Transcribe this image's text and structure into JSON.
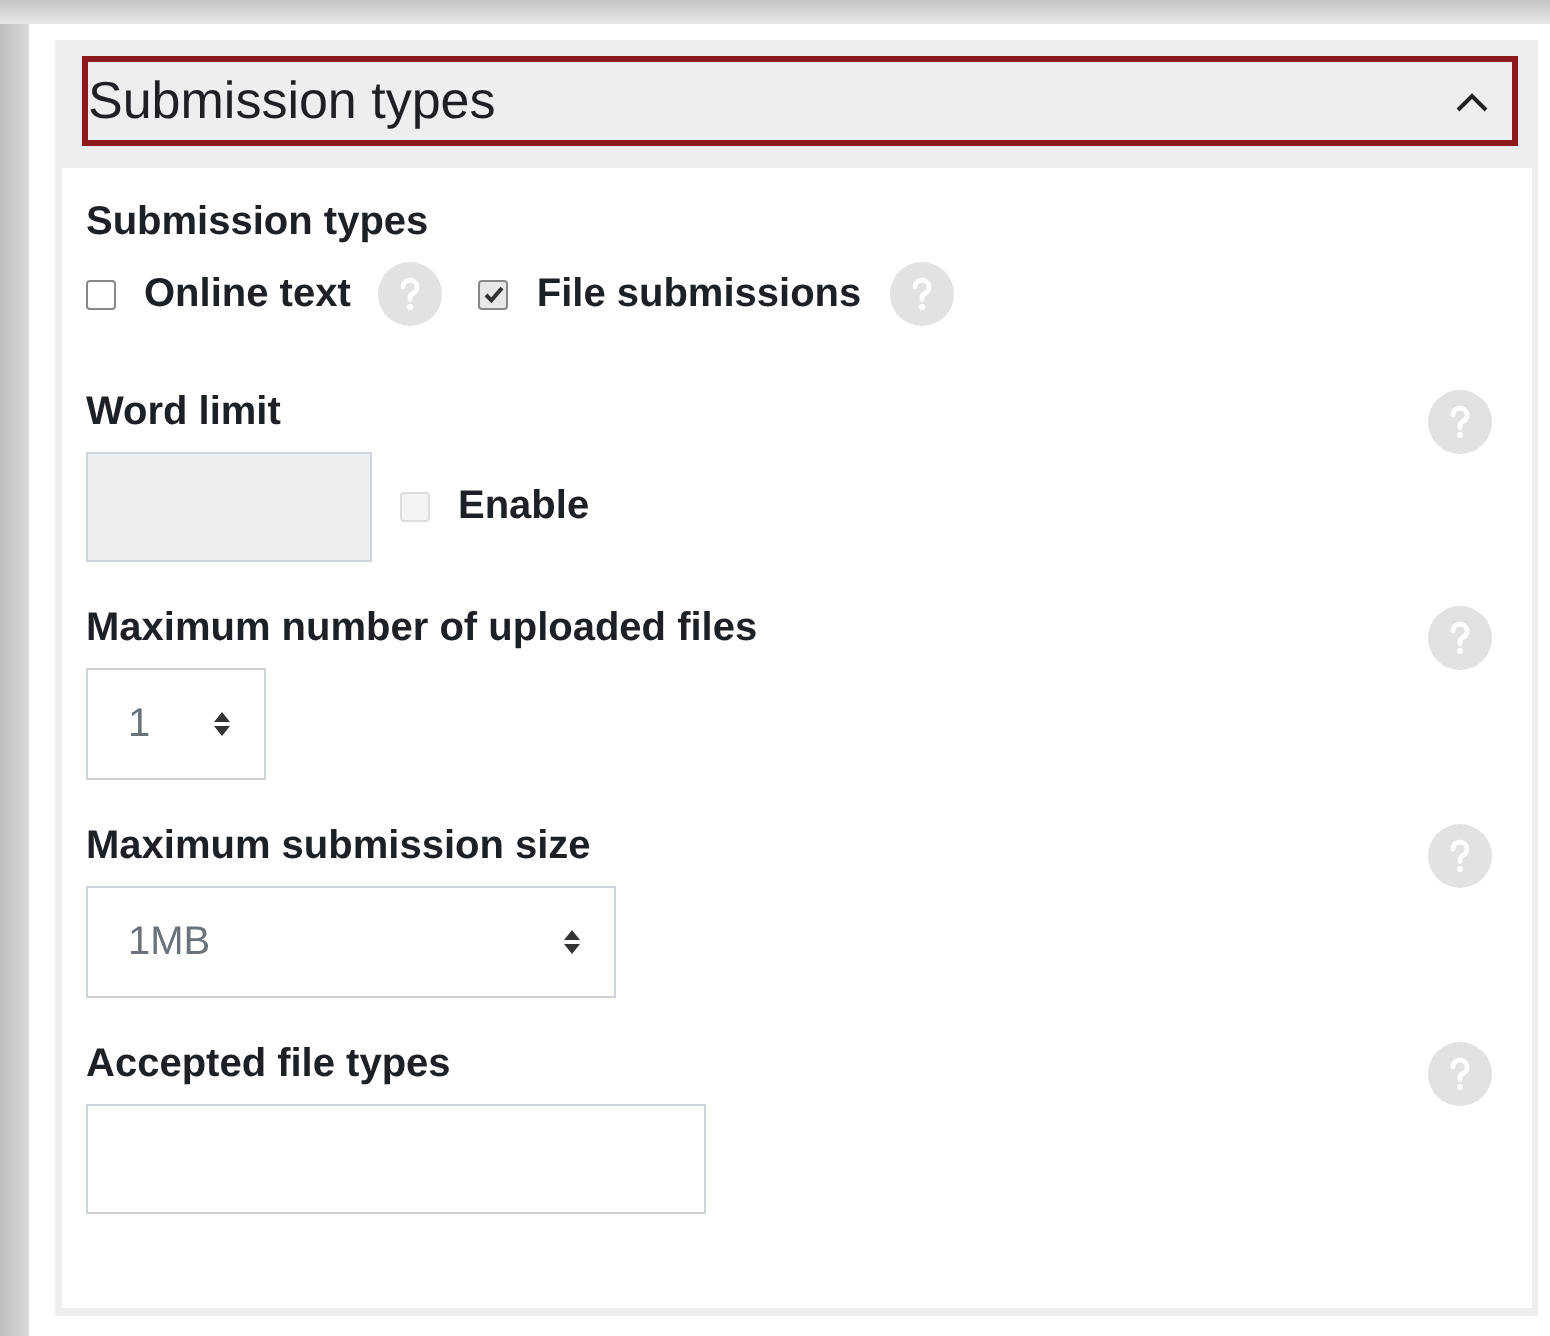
{
  "section": {
    "title": "Submission types",
    "expanded": true
  },
  "fields": [
    {
      "kind": "checkgroup",
      "label": "Submission types",
      "options": [
        {
          "label": "Online text",
          "checked": false
        },
        {
          "label": "File submissions",
          "checked": true
        }
      ]
    },
    {
      "kind": "word_limit",
      "label": "Word limit",
      "checkbox": {
        "label": "Enable",
        "checked": false,
        "disabled": true
      }
    },
    {
      "kind": "select",
      "label": "Maximum number of uploaded files",
      "value": "1"
    },
    {
      "kind": "select",
      "label": "Maximum submission size",
      "value": "1MB"
    },
    {
      "kind": "text",
      "label": "Accepted file types"
    }
  ]
}
